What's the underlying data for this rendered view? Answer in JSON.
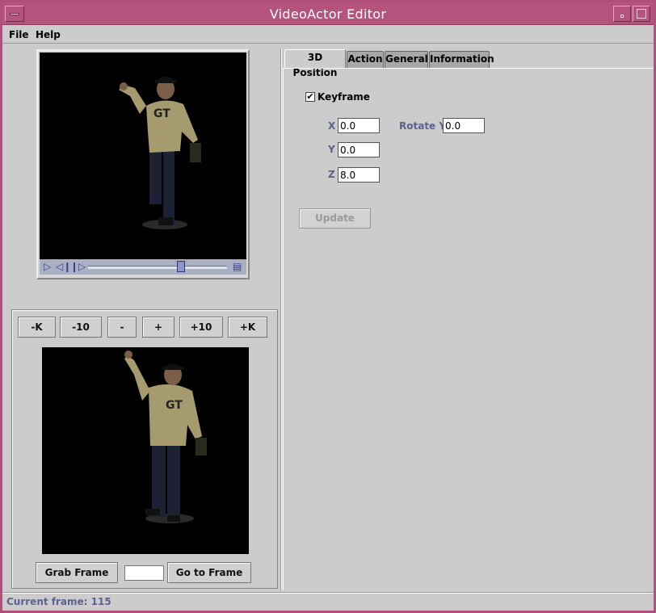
{
  "window": {
    "title": "VideoActor Editor"
  },
  "menu": {
    "file": "File",
    "help": "Help"
  },
  "player": {
    "play_icon": "play-icon",
    "step_back_icon": "step-back-icon",
    "step_forward_icon": "step-forward-icon",
    "film_icon": "film-icon",
    "position_fraction": 0.67
  },
  "frame_nav": {
    "minus_k": "-K",
    "minus_10": "-10",
    "minus": "-",
    "plus": "+",
    "plus_10": "+10",
    "plus_k": "+K",
    "grab_frame": "Grab Frame",
    "go_to_frame": "Go to Frame",
    "frame_input_value": ""
  },
  "tabs": [
    {
      "label": "3D Position",
      "active": true
    },
    {
      "label": "Action",
      "active": false
    },
    {
      "label": "General",
      "active": false
    },
    {
      "label": "Information",
      "active": false
    }
  ],
  "position": {
    "keyframe_label": "Keyframe",
    "keyframe_checked": true,
    "x_label": "X",
    "x_value": "0.0",
    "y_label": "Y",
    "y_value": "0.0",
    "z_label": "Z",
    "z_value": "8.0",
    "rotate_y_label": "Rotate Y",
    "rotate_y_value": "0.0",
    "update": "Update"
  },
  "status": {
    "text": "Current frame: 115"
  },
  "colors": {
    "titlebar": "#b4537c",
    "panel": "#cccccc",
    "label_blue": "#5e6090",
    "video_bg": "#000000"
  }
}
